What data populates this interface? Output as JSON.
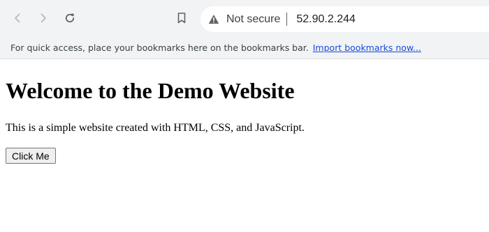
{
  "browser": {
    "nav": {
      "back_icon": "chevron-left-icon",
      "forward_icon": "chevron-right-icon",
      "reload_icon": "reload-icon",
      "bookmark_icon": "bookmark-icon"
    },
    "omnibox": {
      "security_icon": "warning-triangle-icon",
      "security_label": "Not secure",
      "url": "52.90.2.244"
    },
    "bookmarks_bar": {
      "hint": "For quick access, place your bookmarks here on the bookmarks bar.",
      "import_link": "Import bookmarks now..."
    },
    "colors": {
      "toolbar_bg": "#f1f3f4",
      "link": "#1a4bd6",
      "icon": "#5f6368"
    }
  },
  "page": {
    "heading": "Welcome to the Demo Website",
    "paragraph": "This is a simple website created with HTML, CSS, and JavaScript.",
    "button_label": "Click Me"
  }
}
